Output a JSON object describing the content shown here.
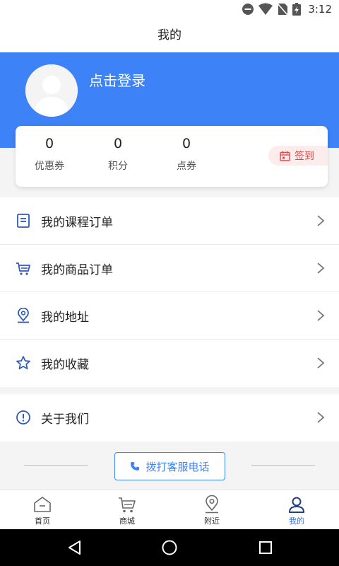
{
  "status": {
    "time": "3:12"
  },
  "header": {
    "title": "我的"
  },
  "profile": {
    "login_text": "点击登录"
  },
  "stats": [
    {
      "value": "0",
      "label": "优惠券"
    },
    {
      "value": "0",
      "label": "积分"
    },
    {
      "value": "0",
      "label": "点券"
    }
  ],
  "checkin": {
    "label": "签到"
  },
  "menu": [
    {
      "label": "我的课程订单",
      "icon": "document-icon"
    },
    {
      "label": "我的商品订单",
      "icon": "cart-icon"
    },
    {
      "label": "我的地址",
      "icon": "location-icon"
    },
    {
      "label": "我的收藏",
      "icon": "star-icon"
    }
  ],
  "menu2": [
    {
      "label": "关于我们",
      "icon": "info-icon"
    }
  ],
  "service": {
    "call_label": "拨打客服电话"
  },
  "tabs": [
    {
      "label": "首页",
      "icon": "home-icon"
    },
    {
      "label": "商城",
      "icon": "cart-icon"
    },
    {
      "label": "附近",
      "icon": "location-icon"
    },
    {
      "label": "我的",
      "icon": "user-icon"
    }
  ],
  "colors": {
    "primary": "#3d82f7",
    "checkin_bg": "#fdecec",
    "checkin_text": "#e0494a",
    "active_tab": "#3d6fd6"
  }
}
